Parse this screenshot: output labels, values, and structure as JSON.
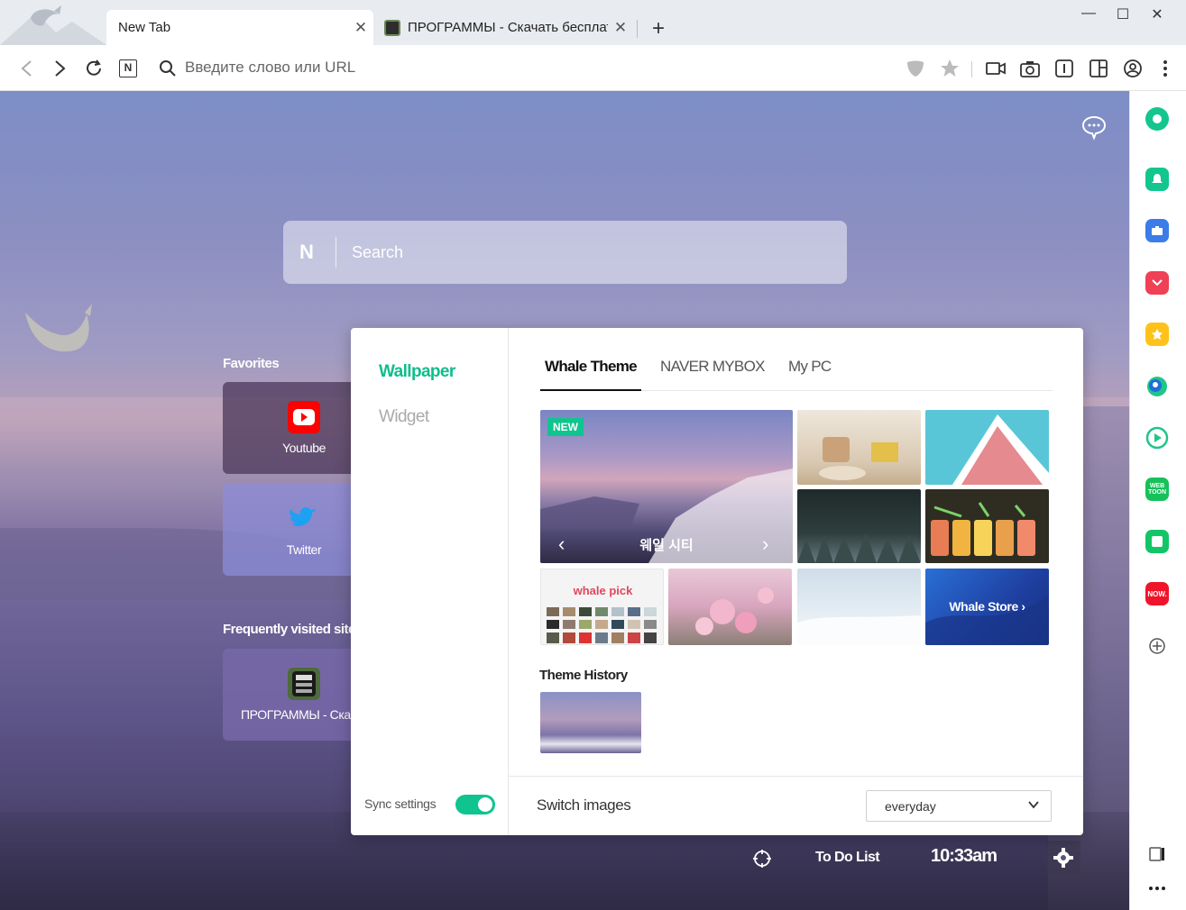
{
  "tabs": [
    {
      "title": "New Tab",
      "active": true
    },
    {
      "title": "ПРОГРАММЫ - Скачать бесплатные программы",
      "active": false
    }
  ],
  "window_controls": {
    "minimize": "—",
    "maximize": "☐",
    "close": "✕"
  },
  "toolbar": {
    "address_placeholder": "Введите слово или URL",
    "naver_btn": "N"
  },
  "newtab": {
    "search": {
      "logo": "N",
      "placeholder": "Search"
    },
    "favorites": {
      "title": "Favorites",
      "items": [
        {
          "label": "Youtube",
          "icon": "youtube-icon"
        },
        {
          "label": "Twitter",
          "icon": "twitter-icon"
        }
      ]
    },
    "frequent": {
      "title": "Frequently visited sites",
      "items": [
        {
          "label": "ПРОГРАММЫ - Скачать бесплатные программы",
          "icon": "site-favicon"
        }
      ]
    },
    "bottom_bar": {
      "todo": "To Do List",
      "time": "10:33am"
    }
  },
  "settings_panel": {
    "menu": {
      "wallpaper": "Wallpaper",
      "widget": "Widget"
    },
    "sync_label": "Sync settings",
    "sync_enabled": true,
    "tabs": {
      "whale_theme": "Whale Theme",
      "naver_mybox": "NAVER MYBOX",
      "my_pc": "My PC"
    },
    "featured": {
      "badge": "NEW",
      "caption": "웨일 시티"
    },
    "whale_pick": "whale pick",
    "whale_store": "Whale Store",
    "theme_history": "Theme History",
    "switch_images": "Switch images",
    "switch_value": "everyday"
  },
  "colors": {
    "accent": "#10c48f",
    "youtube": "#ff0000",
    "twitter": "#1da1f2"
  }
}
